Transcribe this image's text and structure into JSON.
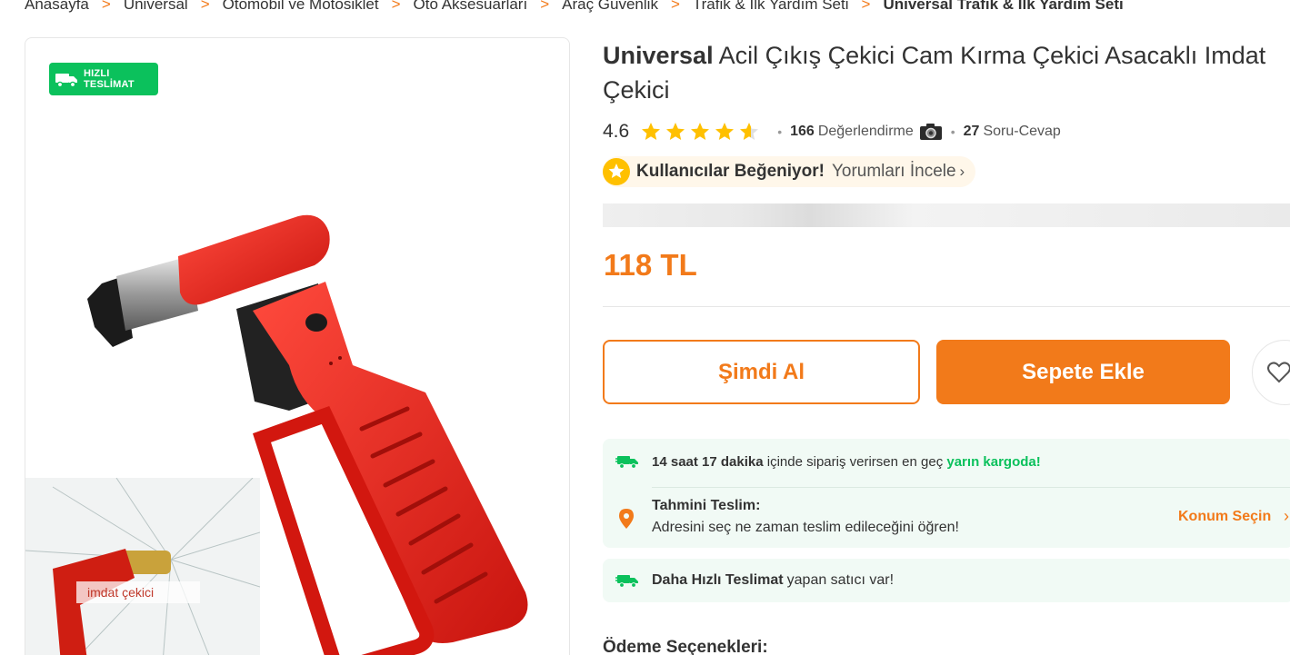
{
  "breadcrumb": {
    "items": [
      "Anasayfa",
      "Universal",
      "Otomobil ve Motosiklet",
      "Oto Aksesuarları",
      "Araç Güvenlik",
      "Trafik & İlk Yardım Seti",
      "Universal Trafik & İlk Yardım Seti"
    ]
  },
  "badge": {
    "line1": "HIZLI",
    "line2": "TESLİMAT"
  },
  "thumbnail": {
    "label": "imdat çekici"
  },
  "product": {
    "brand": "Universal",
    "name": "Acil Çıkış Çekici Cam Kırma Çekici Asacaklı Imdat Çekici",
    "rating": "4.6",
    "rating_stars": 4.6,
    "review_count": "166",
    "review_label": "Değerlendirme",
    "qa_count": "27",
    "qa_label": "Soru-Cevap",
    "price": "118 TL"
  },
  "liked": {
    "text": "Kullanıcılar Beğeniyor!",
    "link": "Yorumları İncele"
  },
  "actions": {
    "buy_now": "Şimdi Al",
    "add_to_cart": "Sepete Ekle"
  },
  "shipping": {
    "time": "14 saat 17 dakika",
    "middle": "içinde sipariş verirsen en geç",
    "highlight": "yarın kargoda!",
    "estimate_title": "Tahmini Teslim:",
    "estimate_desc": "Adresini seç ne zaman teslim edileceğini öğren!",
    "location_link": "Konum Seçin"
  },
  "faster": {
    "bold": "Daha Hızlı Teslimat",
    "rest": "yapan satıcı var!"
  },
  "payment": {
    "title": "Ödeme Seçenekleri:"
  },
  "colors": {
    "accent": "#f27a1a",
    "green": "#0bc15c",
    "star": "#ffc000",
    "ship_bg": "#f1faf5"
  },
  "icons": {
    "truck": "truck-icon",
    "star": "star-icon",
    "camera": "camera-icon",
    "pin": "location-pin-icon",
    "heart": "heart-icon",
    "chevron": "chevron-right-icon"
  }
}
